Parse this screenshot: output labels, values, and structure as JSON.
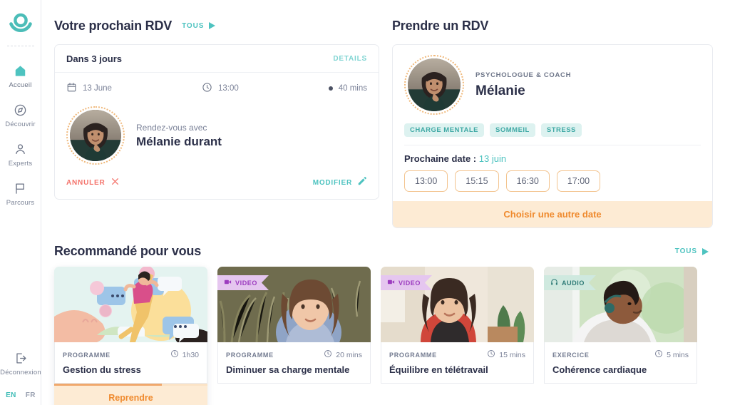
{
  "brand": {
    "logo_icon": "eye-logo-icon",
    "accent": "#4ec3c0",
    "orange": "#ef8a2e",
    "red": "#f4736b"
  },
  "sidebar": {
    "items": [
      {
        "label": "Accueil",
        "icon": "home-icon",
        "active": true
      },
      {
        "label": "Découvrir",
        "icon": "compass-icon",
        "active": false
      },
      {
        "label": "Experts",
        "icon": "person-icon",
        "active": false
      },
      {
        "label": "Parcours",
        "icon": "flag-icon",
        "active": false
      }
    ],
    "logout": {
      "label": "Déconnexion",
      "icon": "logout-icon"
    },
    "languages": [
      {
        "code": "EN",
        "active": true
      },
      {
        "code": "FR",
        "active": false
      }
    ]
  },
  "next_appointment": {
    "section_title": "Votre prochain RDV",
    "all_link": "TOUS",
    "when": "Dans 3 jours",
    "details_link": "DETAILS",
    "date": "13 June",
    "date_icon": "calendar-icon",
    "time": "13:00",
    "time_icon": "clock-icon",
    "duration": "40 mins",
    "duration_icon": "dot-icon",
    "with_label": "Rendez-vous avec",
    "practitioner": "Mélanie durant",
    "cancel_label": "ANNULER",
    "cancel_icon": "close-icon",
    "modify_label": "MODIFIER",
    "modify_icon": "pencil-icon"
  },
  "booking": {
    "section_title": "Prendre un RDV",
    "role": "PSYCHOLOGUE & COACH",
    "name": "Mélanie",
    "tags": [
      "CHARGE MENTALE",
      "SOMMEIL",
      "STRESS"
    ],
    "next_date_label": "Prochaine date :",
    "next_date_value": "13 juin",
    "slots": [
      "13:00",
      "15:15",
      "16:30",
      "17:00"
    ],
    "other_date_label": "Choisir une autre date"
  },
  "recommended": {
    "section_title": "Recommandé pour vous",
    "all_link": "TOUS",
    "cards": [
      {
        "kind": "PROGRAMME",
        "title": "Gestion du stress",
        "duration": "1h30",
        "duration_icon": "clock-icon",
        "badge": null,
        "progress_percent": 70,
        "cta": "Reprendre",
        "thumb_kind": "illustration"
      },
      {
        "kind": "PROGRAMME",
        "title": "Diminuer sa charge mentale",
        "duration": "20 mins",
        "duration_icon": "clock-icon",
        "badge": {
          "label": "VIDEO",
          "icon": "video-camera-icon",
          "type": "video"
        },
        "progress_percent": 0,
        "cta": null,
        "thumb_kind": "photo-woman-plant"
      },
      {
        "kind": "PROGRAMME",
        "title": "Équilibre en télétravail",
        "duration": "15 mins",
        "duration_icon": "clock-icon",
        "badge": {
          "label": "VIDEO",
          "icon": "video-camera-icon",
          "type": "video"
        },
        "progress_percent": 0,
        "cta": null,
        "thumb_kind": "photo-woman-chair"
      },
      {
        "kind": "EXERCICE",
        "title": "Cohérence cardiaque",
        "duration": "5 mins",
        "duration_icon": "clock-icon",
        "badge": {
          "label": "AUDIO",
          "icon": "headphones-icon",
          "type": "audio"
        },
        "progress_percent": 0,
        "cta": null,
        "thumb_kind": "photo-man-headphones"
      }
    ]
  }
}
